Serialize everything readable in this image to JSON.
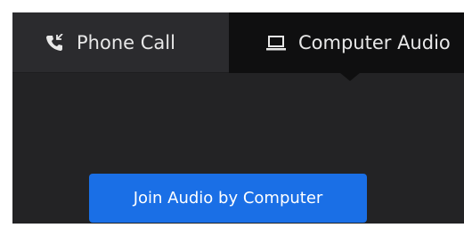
{
  "tabs": [
    {
      "label": "Phone Call",
      "icon": "phone-icon",
      "active": false
    },
    {
      "label": "Computer Audio",
      "icon": "laptop-icon",
      "active": true
    }
  ],
  "join_button": {
    "label": "Join Audio by Computer"
  },
  "colors": {
    "background": "#232325",
    "tab_inactive": "#2b2b2e",
    "tab_active": "#0f0f10",
    "button": "#1a6fe6",
    "text": "#e8e8e8"
  }
}
